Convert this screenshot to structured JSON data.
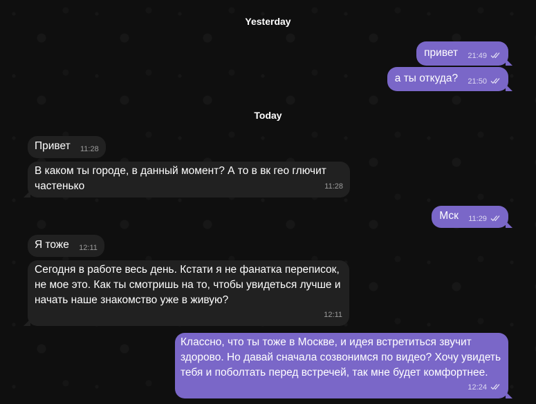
{
  "separators": {
    "yesterday": "Yesterday",
    "today": "Today"
  },
  "colors": {
    "background": "#0f0f0f",
    "incoming_bubble": "#212121",
    "outgoing_bubble": "#7a67c8"
  },
  "messages": [
    {
      "direction": "out",
      "text": "привет",
      "time": "21:49",
      "status": "read"
    },
    {
      "direction": "out",
      "text": "а ты откуда?",
      "time": "21:50",
      "status": "read"
    },
    {
      "direction": "in",
      "text": "Привет",
      "time": "11:28"
    },
    {
      "direction": "in",
      "text": "В каком ты городе, в данный момент? А то в вк гео глючит частенько",
      "time": "11:28"
    },
    {
      "direction": "out",
      "text": "Мск",
      "time": "11:29",
      "status": "read"
    },
    {
      "direction": "in",
      "text": "Я тоже",
      "time": "12:11"
    },
    {
      "direction": "in",
      "text": "Сегодня в работе весь день. Кстати я не фанатка переписок, не мое это. Как ты смотришь на то, чтобы увидеться лучше и начать наше знакомство уже в живую?",
      "time": "12:11"
    },
    {
      "direction": "out",
      "text": "Классно, что ты тоже в Москве, и идея встретиться звучит здорово. Но давай сначала созвонимся по видео? Хочу увидеть тебя и поболтать перед встречей, так мне будет комфортнее.",
      "time": "12:24",
      "status": "read"
    }
  ]
}
